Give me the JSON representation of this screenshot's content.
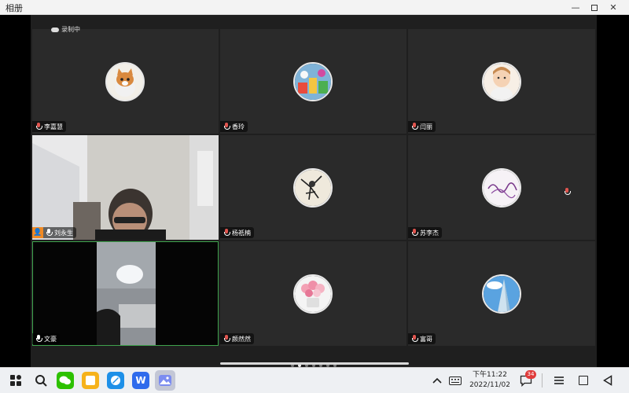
{
  "window": {
    "title": "相册"
  },
  "recording": {
    "label": "录制中"
  },
  "participants": [
    {
      "name": "李嘉慧",
      "avatar": "cat-avatar"
    },
    {
      "name": "香玲",
      "avatar": "toys-avatar"
    },
    {
      "name": "闫丽",
      "avatar": "child-avatar"
    },
    {
      "name": "刘永生",
      "avatar": "video-feed"
    },
    {
      "name": "杨祇楠",
      "avatar": "drawing-avatar"
    },
    {
      "name": "苏李杰",
      "avatar": "signature-avatar"
    },
    {
      "name": "文豪",
      "avatar": "video-feed"
    },
    {
      "name": "颜然然",
      "avatar": "flowers-avatar"
    },
    {
      "name": "富哥",
      "avatar": "sky-avatar"
    }
  ],
  "pagination": {
    "pages": 7,
    "current": 2
  },
  "taskbar": {
    "time": "下午11:22",
    "date": "2022/11/02",
    "notification_count": "34",
    "apps": [
      "start-icon",
      "search-icon",
      "wechat-icon",
      "notes-icon",
      "browser-icon",
      "wps-icon",
      "gallery-icon"
    ]
  },
  "colors": {
    "active_border": "#3fa34d",
    "host_badge": "#f08a24"
  }
}
